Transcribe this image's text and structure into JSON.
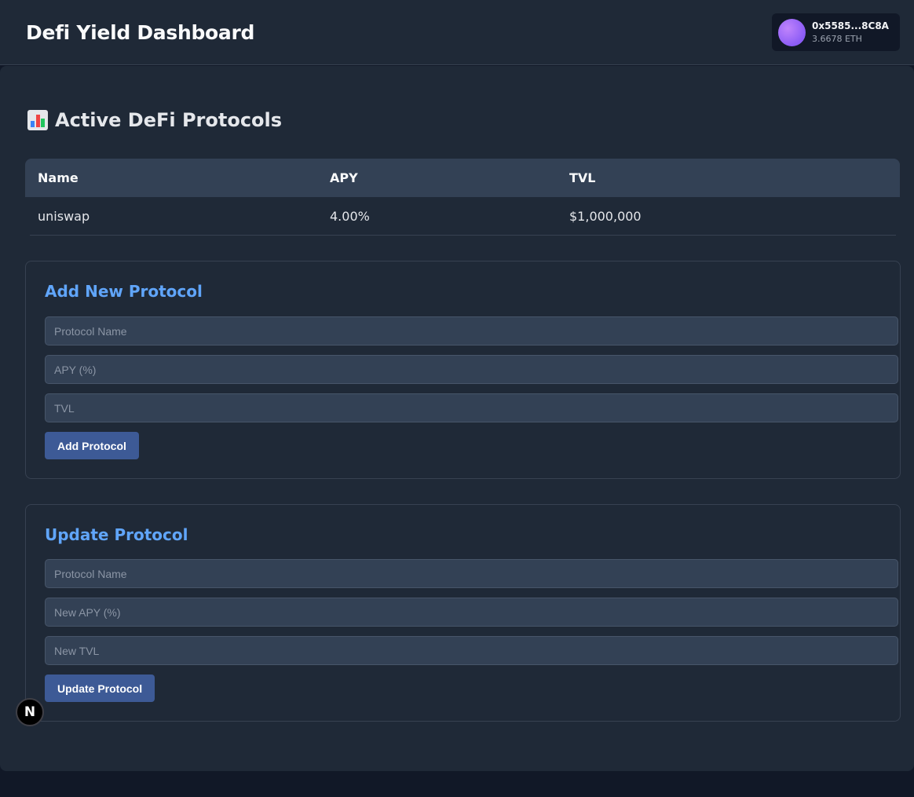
{
  "header": {
    "title": "Defi Yield Dashboard",
    "wallet": {
      "address": "0x5585...8C8A",
      "balance": "3.6678 ETH"
    }
  },
  "protocols_section": {
    "title": "Active DeFi Protocols",
    "icon": "bar-chart-icon",
    "columns": [
      "Name",
      "APY",
      "TVL"
    ],
    "rows": [
      {
        "name": "uniswap",
        "apy": "4.00%",
        "tvl": "$1,000,000"
      }
    ]
  },
  "add_form": {
    "title": "Add New Protocol",
    "name_placeholder": "Protocol Name",
    "apy_placeholder": "APY (%)",
    "tvl_placeholder": "TVL",
    "button_label": "Add Protocol"
  },
  "update_form": {
    "title": "Update Protocol",
    "name_placeholder": "Protocol Name",
    "apy_placeholder": "New APY (%)",
    "tvl_placeholder": "New TVL",
    "button_label": "Update Protocol"
  },
  "dev_badge": {
    "label": "N",
    "icon": "nextjs-logo-icon"
  },
  "colors": {
    "accent": "#60a5fa",
    "button": "#3d5a96",
    "surface": "#1f2937",
    "background": "#111827"
  }
}
